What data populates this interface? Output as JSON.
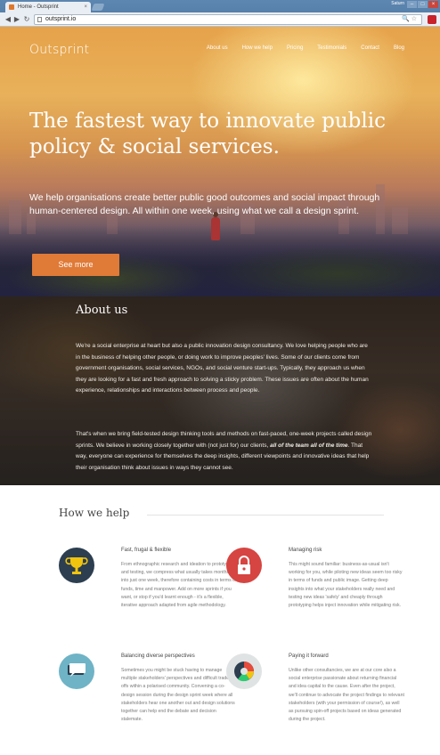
{
  "browser": {
    "tab_title": "Home - Outsprint",
    "tab_close": "×",
    "user": "Saturn",
    "url": "outsprint.io",
    "back": "◀",
    "forward": "▶",
    "reload": "↻",
    "minimize": "–",
    "maximize": "□",
    "close": "×",
    "omnibox_tools": "🔍☆"
  },
  "hero": {
    "brand": "Outsprint",
    "nav": [
      "About us",
      "How we help",
      "Pricing",
      "Testimonials",
      "Contact",
      "Blog"
    ],
    "headline": "The fastest way to innovate public policy & social services.",
    "subheadline": "We help organisations create better public good outcomes and social impact through human-centered design. All within one week, using what we call a design sprint.",
    "cta": "See more"
  },
  "about": {
    "title": "About us",
    "p1": "We're a social enterprise at heart but also a public innovation design consultancy. We love helping people who are in the business of helping other people, or doing work to improve peoples' lives. Some of our clients come from government organisations, social services, NGOs, and social venture start-ups. Typically, they approach us when they are looking for a fast and fresh approach to solving a sticky problem. These issues are often about the human experience, relationships and interactions between process and people.",
    "p2_a": "That's when we bring field-tested design thinking tools and methods on fast-paced, one-week projects called design sprints. We believe in working closely together with (not just for) our clients, ",
    "p2_em": "all of the team all of the time",
    "p2_b": ". That way, everyone can experience for themselves the deep insights, different viewpoints and innovative ideas that help their organisation think about issues in ways they cannot see."
  },
  "how": {
    "title": "How we help",
    "features": [
      {
        "title": "Fast, frugal & flexible",
        "icon": "trophy-icon",
        "text": "From ethnographic research and ideation to prototyping and testing, we compress what usually takes months into just one week, therefore containing costs in terms of funds, time and manpower. Add on more sprints if you want, or stop if you'd learnt enough - it's a flexible, iterative approach adapted from agile methodology."
      },
      {
        "title": "Managing risk",
        "icon": "padlock-icon",
        "text": "This might sound familiar: business-as-usual isn't working for you, while piloting new ideas seem too risky in terms of funds and public image. Getting deep insights into what your stakeholders really need and testing new ideas 'safely' and cheaply through prototyping helps inject innovation while mitigating risk."
      },
      {
        "title": "Balancing diverse perspectives",
        "icon": "speech-bubbles-icon",
        "text": "Sometimes you might be stuck having to manage multiple stakeholders' perspectives and difficult trade-offs within a polarised community. Convening a co-design session during the design sprint week where all stakeholders hear one another out and design solutions together can help end the debate and decision stalemate."
      },
      {
        "title": "Paying it forward",
        "icon": "pie-chart-icon",
        "text": "Unlike other consultancies, we are at our core also a social enterprise passionate about returning financial and idea capital to the cause. Even after the project, we'll continue to advocate the project findings to relevant stakeholders (with your permission of course!), as well as pursuing spin-off projects based on ideas generated during the project."
      }
    ]
  }
}
